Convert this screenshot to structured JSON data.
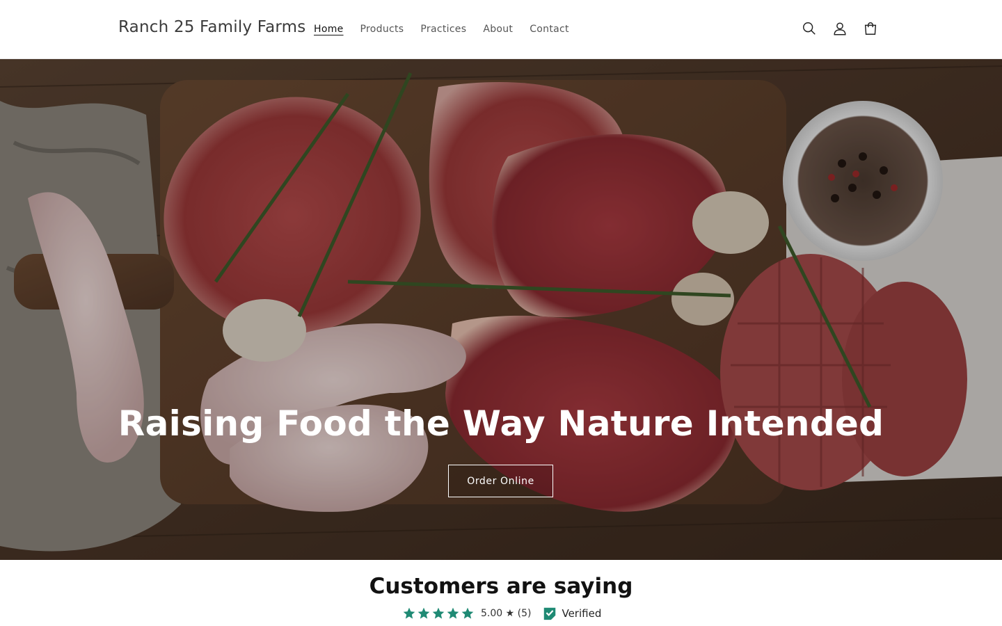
{
  "header": {
    "brand": "Ranch 25 Family Farms",
    "nav": [
      {
        "label": "Home",
        "active": true
      },
      {
        "label": "Products"
      },
      {
        "label": "Practices"
      },
      {
        "label": "About"
      },
      {
        "label": "Contact"
      }
    ],
    "icons": [
      "search-icon",
      "account-icon",
      "cart-icon"
    ]
  },
  "hero": {
    "title": "Raising Food the Way Nature Intended",
    "button_label": "Order Online"
  },
  "reviews": {
    "title": "Customers are saying",
    "rating_value": "5.00",
    "rating_count": "(5)",
    "rating_stars": 5,
    "verified_label": "Verified",
    "star_color": "#1f8a74"
  },
  "colors": {
    "accent": "#1f8a74",
    "text": "#121212"
  }
}
